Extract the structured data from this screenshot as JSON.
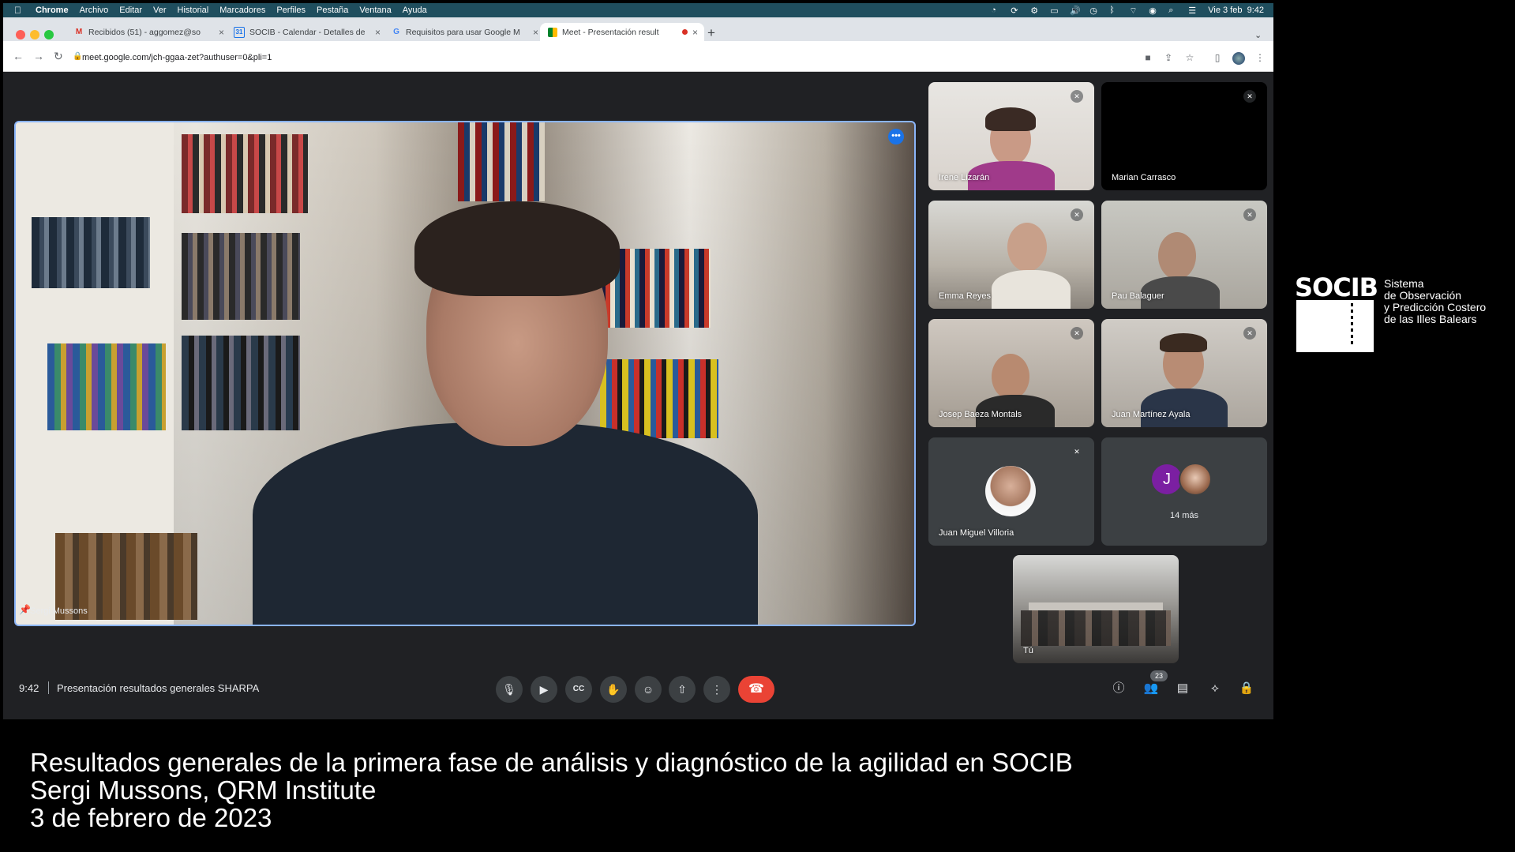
{
  "menubar": {
    "apple": "",
    "app": "Chrome",
    "items": [
      "Archivo",
      "Editar",
      "Ver",
      "Historial",
      "Marcadores",
      "Perfiles",
      "Pestaña",
      "Ventana",
      "Ayuda"
    ],
    "datetime": "Vie 3 feb  9:42"
  },
  "tabs": [
    {
      "icon": "gmail-icon",
      "label": "Recibidos (51) - aggomez@so",
      "close": "×"
    },
    {
      "icon": "calendar-icon",
      "label": "SOCIB - Calendar - Detalles de",
      "close": "×"
    },
    {
      "icon": "google-icon",
      "label": "Requisitos para usar Google M",
      "close": "×"
    },
    {
      "icon": "meet-icon",
      "label": "Meet - Presentación result",
      "close": "×",
      "active": true
    }
  ],
  "new_tab": "+",
  "address": {
    "url": "meet.google.com/jch-ggaa-zet?authuser=0&pli=1"
  },
  "meeting": {
    "time": "9:42",
    "title": "Presentación resultados generales SHARPA",
    "main_speaker": "Sergi Mussons",
    "participants_count": "23",
    "more_label": "14 más",
    "more_avatar_initial": "J",
    "self_label": "Tú",
    "participants": [
      {
        "name": "Irene Lizarán",
        "muted": true
      },
      {
        "name": "Marian Carrasco",
        "muted": true
      },
      {
        "name": "Emma Reyes",
        "muted": true
      },
      {
        "name": "Pau Balaguer",
        "muted": true
      },
      {
        "name": "Josep Baeza Montals",
        "muted": true
      },
      {
        "name": "Juan Martínez Ayala",
        "muted": true
      },
      {
        "name": "Juan Miguel Villoria",
        "muted": true
      }
    ]
  },
  "controls": [
    "mic-icon",
    "camera-icon",
    "captions-icon",
    "raise-hand-icon",
    "emoji-icon",
    "present-icon",
    "more-options-icon",
    "end-call-icon"
  ],
  "right_controls": [
    "info-icon",
    "people-icon",
    "chat-icon",
    "activities-icon",
    "host-controls-icon"
  ],
  "logo": {
    "wordmark": "SOCIB",
    "lines": [
      "Sistema",
      "de Observación",
      "y Predicción Costero",
      "de las Illes Balears"
    ]
  },
  "caption": {
    "line1": "Resultados generales de la primera fase de análisis y diagnóstico de la agilidad en SOCIB",
    "line2": "Sergi Mussons, QRM Institute",
    "line3": "3 de febrero de 2023"
  },
  "colors": {
    "menubar": "#1f4e5e",
    "meet_bg": "#202124",
    "tile_bg": "#3c4043",
    "end_call": "#ea4335",
    "active_speaker_border": "#8ab4f8"
  }
}
